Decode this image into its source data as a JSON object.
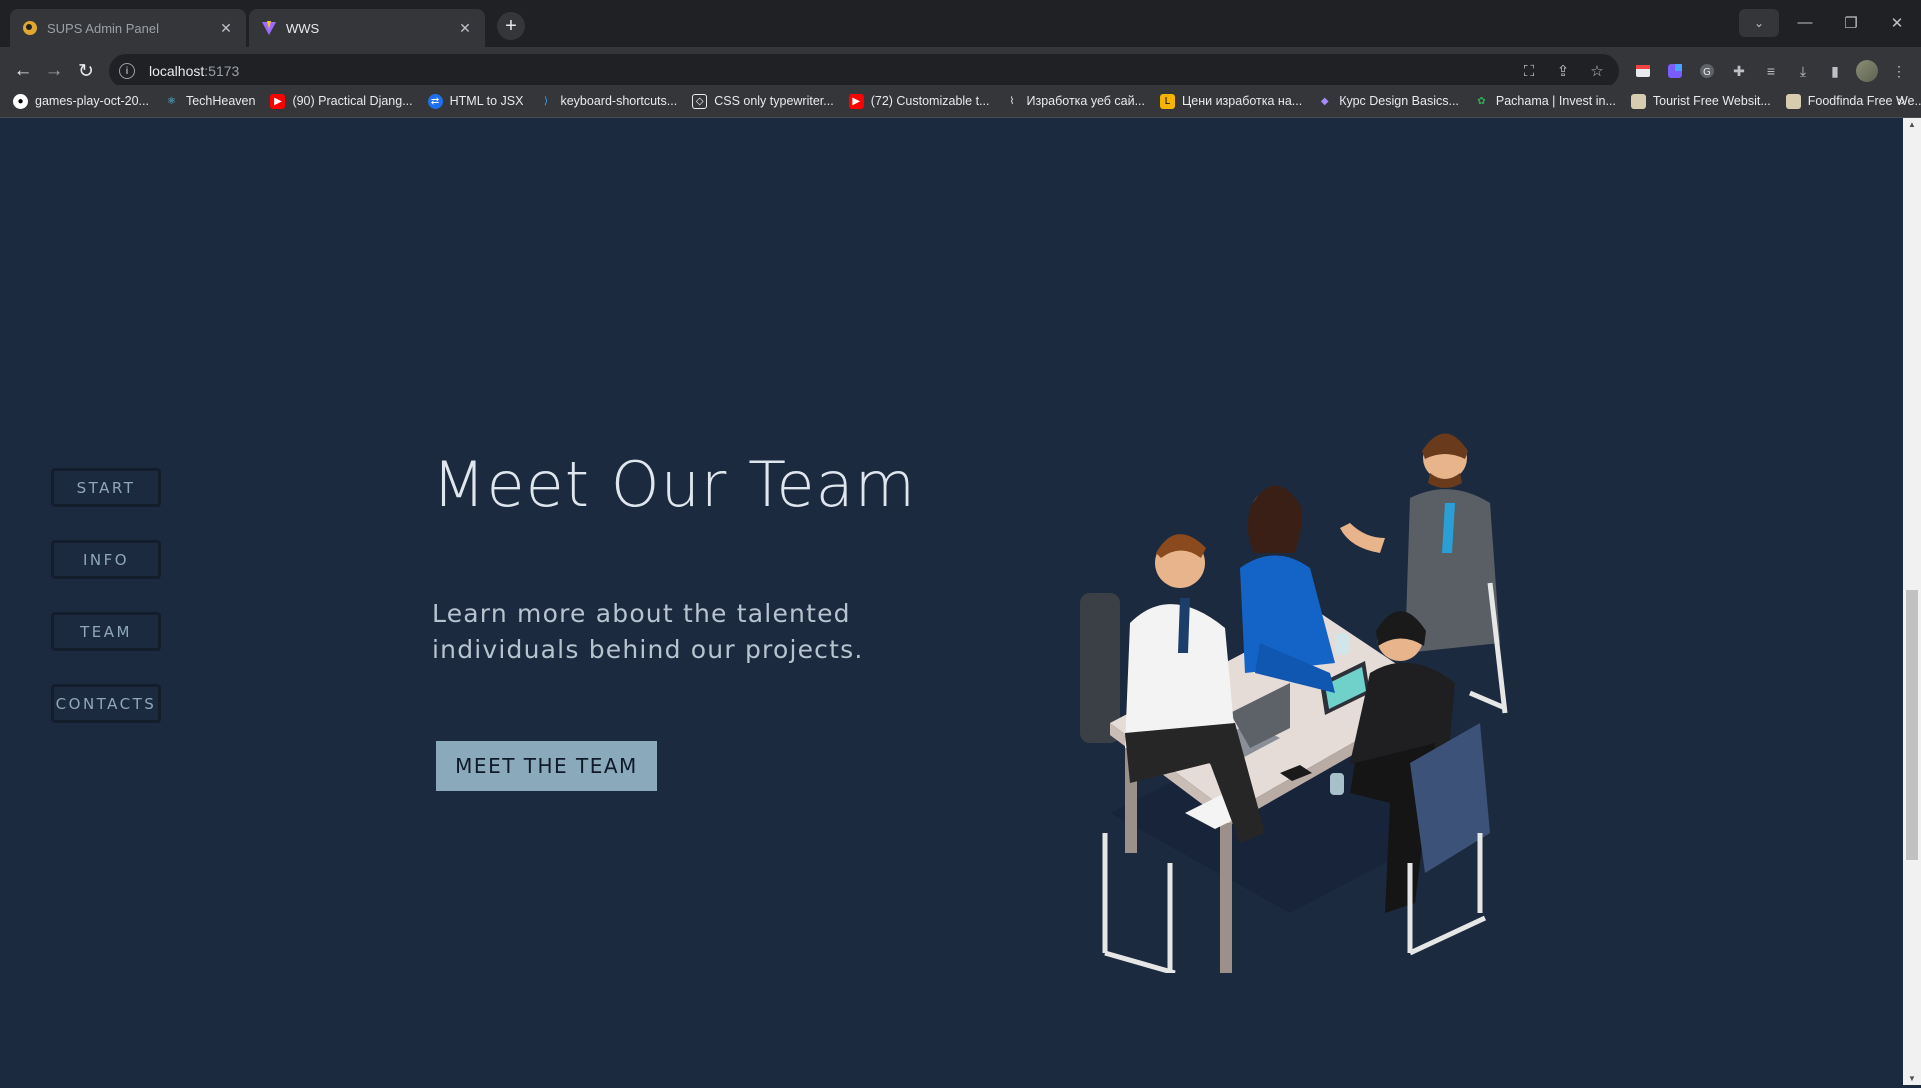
{
  "browser": {
    "tabs": [
      {
        "title": "SUPS Admin Panel",
        "active": false,
        "icon": "sups-favicon"
      },
      {
        "title": "WWS",
        "active": true,
        "icon": "vite-favicon"
      }
    ],
    "url_host": "localhost",
    "url_port": ":5173",
    "bookmarks": [
      {
        "label": "games-play-oct-20...",
        "icon": "github-icon"
      },
      {
        "label": "TechHeaven",
        "icon": "react-icon"
      },
      {
        "label": "(90) Practical Djang...",
        "icon": "youtube-icon"
      },
      {
        "label": "HTML to JSX",
        "icon": "transform-icon"
      },
      {
        "label": "keyboard-shortcuts...",
        "icon": "vscode-icon"
      },
      {
        "label": "CSS only typewriter...",
        "icon": "codepen-icon"
      },
      {
        "label": "(72) Customizable t...",
        "icon": "youtube-icon"
      },
      {
        "label": "Изработка уеб сай...",
        "icon": "site-icon"
      },
      {
        "label": "Цени изработка на...",
        "icon": "site-icon"
      },
      {
        "label": "Курс Design Basics...",
        "icon": "course-icon"
      },
      {
        "label": "Pachama | Invest in...",
        "icon": "pachama-icon"
      },
      {
        "label": "Tourist Free Websit...",
        "icon": "folder-icon"
      },
      {
        "label": "Foodfinda Free We...",
        "icon": "folder-icon"
      }
    ]
  },
  "sidenav": {
    "items": [
      {
        "label": "START"
      },
      {
        "label": "INFO"
      },
      {
        "label": "TEAM"
      },
      {
        "label": "CONTACTS"
      }
    ]
  },
  "hero": {
    "title": "Meet Our Team",
    "subtitle": "Learn more about the talented individuals behind our projects.",
    "button": "MEET THE TEAM"
  },
  "colors": {
    "page_bg": "#1c2a3f",
    "nav_text": "#8ea7b9",
    "button_bg": "#8aa9bb",
    "title_text": "#dfe6ee"
  }
}
